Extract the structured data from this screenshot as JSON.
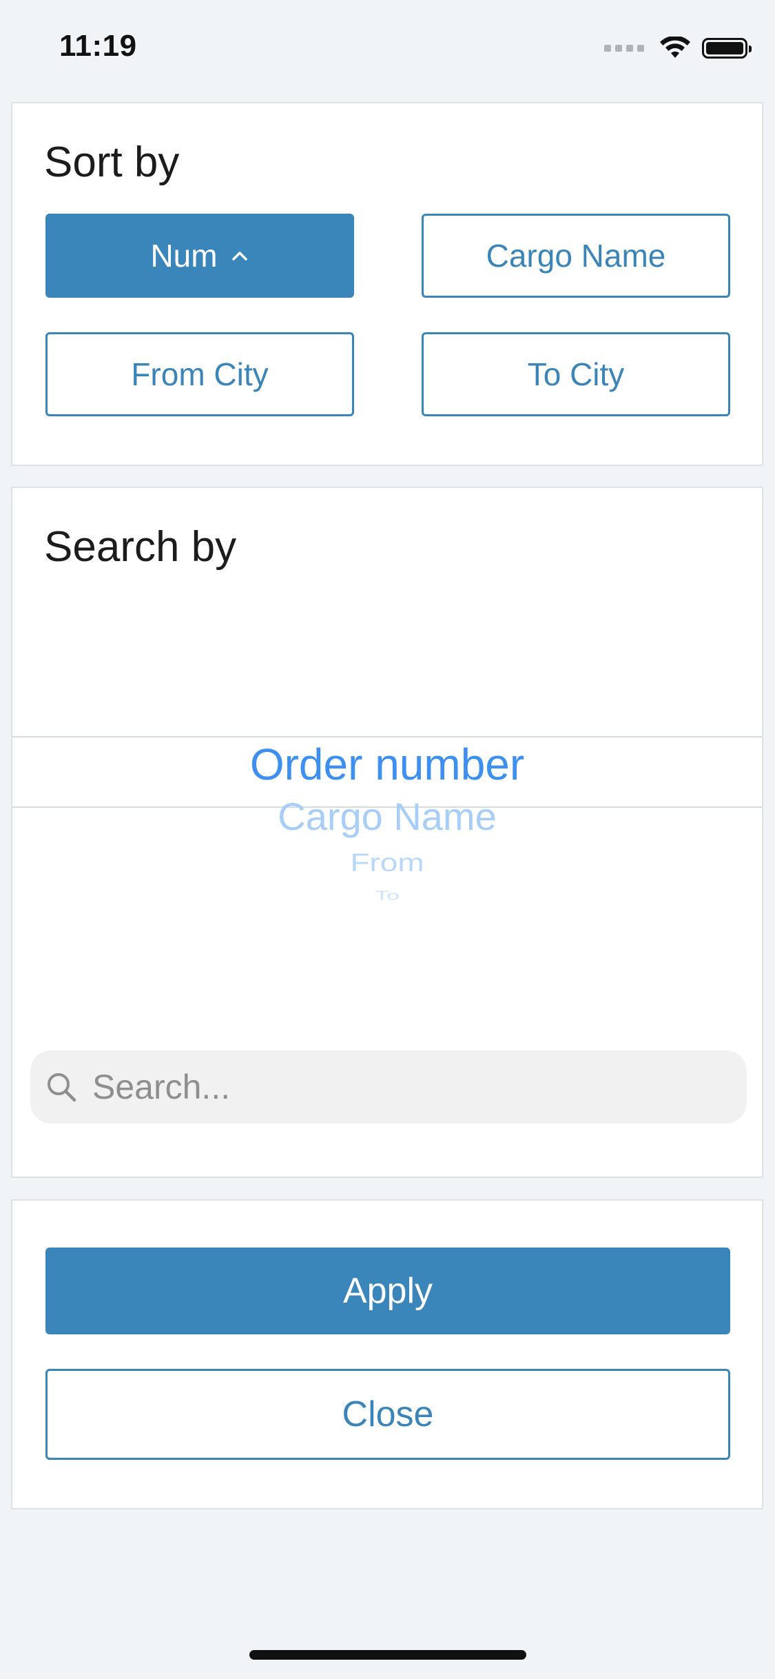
{
  "status_bar": {
    "time": "11:19"
  },
  "sort": {
    "title": "Sort by",
    "options": [
      {
        "label": "Num",
        "active": true,
        "direction": "ascending"
      },
      {
        "label": "Cargo Name",
        "active": false
      },
      {
        "label": "From City",
        "active": false
      },
      {
        "label": "To City",
        "active": false
      }
    ]
  },
  "search": {
    "title": "Search by",
    "picker_items": [
      "Order number",
      "Cargo Name",
      "From",
      "To"
    ],
    "selected_index": 0,
    "placeholder": "Search...",
    "value": ""
  },
  "actions": {
    "apply_label": "Apply",
    "close_label": "Close"
  },
  "colors": {
    "accent": "#3a86bb",
    "picker_text": "#3d8ff0",
    "background": "#f0f4f7",
    "card": "#ffffff"
  },
  "icons": {
    "sort_direction": "chevron-up-icon",
    "search": "search-icon",
    "wifi": "wifi-icon",
    "battery": "battery-icon"
  }
}
